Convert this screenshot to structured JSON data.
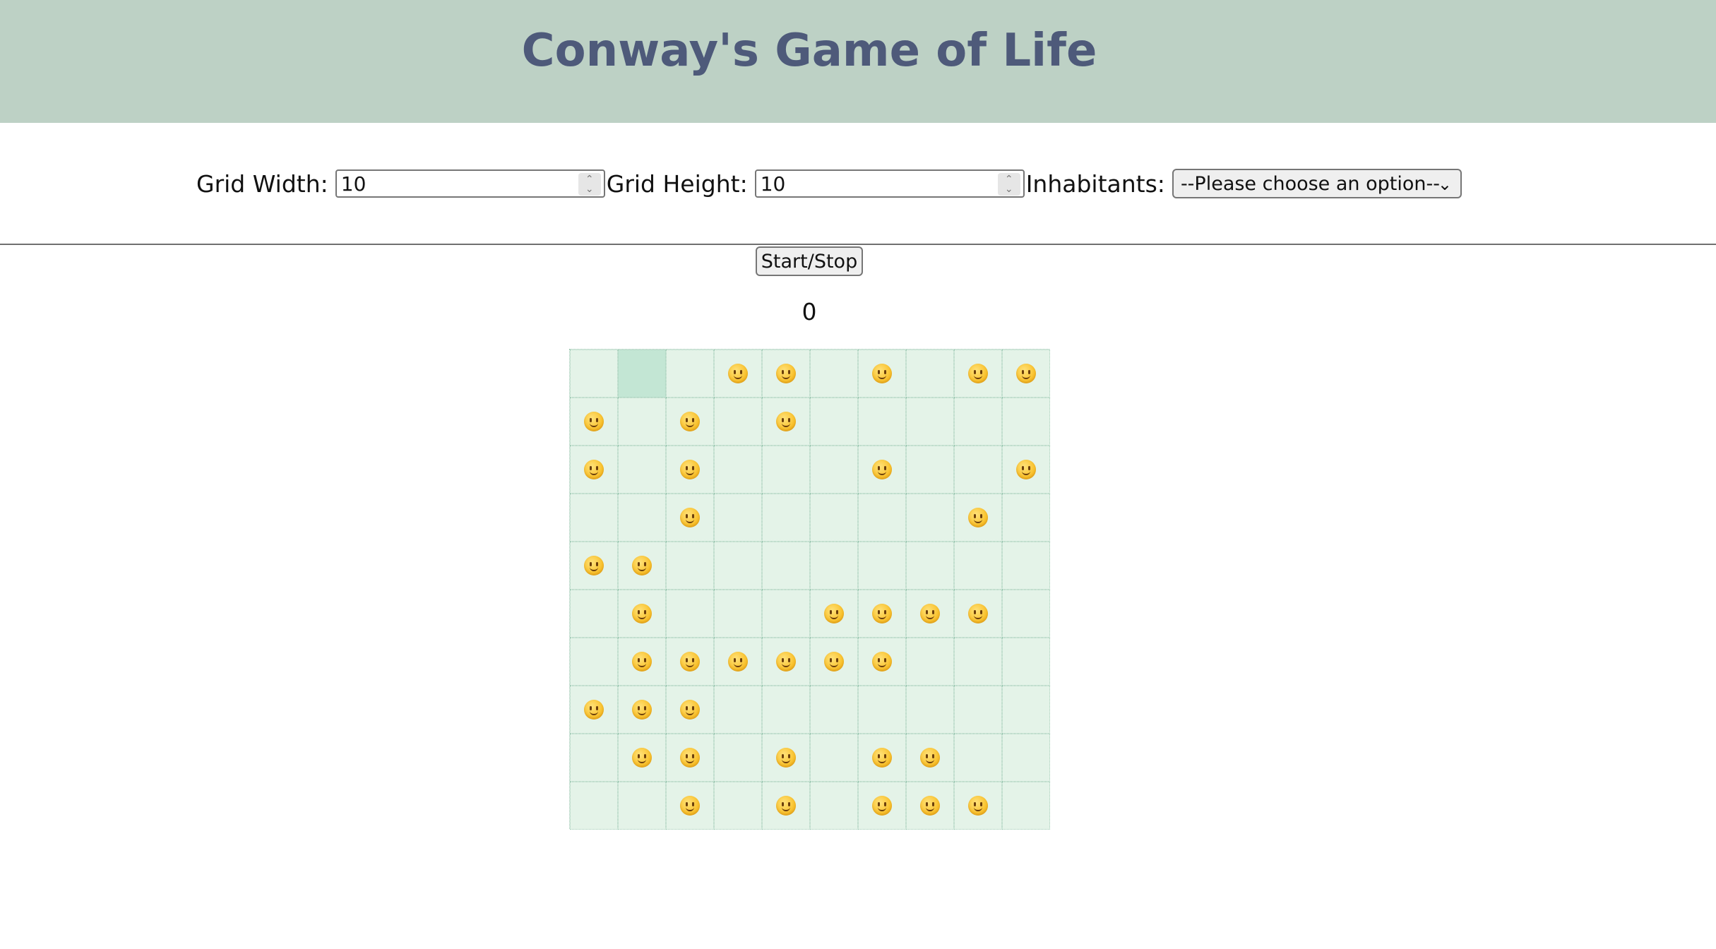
{
  "header": {
    "title": "Conway's Game of Life"
  },
  "controls": {
    "width_label": "Grid Width:",
    "width_value": "10",
    "height_label": "Grid Height:",
    "height_value": "10",
    "inhabitants_label": "Inhabitants:",
    "inhabitants_selected": "--Please choose an option--"
  },
  "start_stop_label": "Start/Stop",
  "generation": "0",
  "grid": {
    "rows": 10,
    "cols": 10,
    "inhabitant_icon": "smiley-face-icon",
    "highlighted_cell": [
      0,
      1
    ],
    "cells": [
      [
        0,
        0,
        0,
        1,
        1,
        0,
        1,
        0,
        1,
        1
      ],
      [
        1,
        0,
        1,
        0,
        1,
        0,
        0,
        0,
        0,
        0
      ],
      [
        1,
        0,
        1,
        0,
        0,
        0,
        1,
        0,
        0,
        1
      ],
      [
        0,
        0,
        1,
        0,
        0,
        0,
        0,
        0,
        1,
        0
      ],
      [
        1,
        1,
        0,
        0,
        0,
        0,
        0,
        0,
        0,
        0
      ],
      [
        0,
        1,
        0,
        0,
        0,
        1,
        1,
        1,
        1,
        0
      ],
      [
        0,
        1,
        1,
        1,
        1,
        1,
        1,
        0,
        0,
        0
      ],
      [
        1,
        1,
        1,
        0,
        0,
        0,
        0,
        0,
        0,
        0
      ],
      [
        0,
        1,
        1,
        0,
        1,
        0,
        1,
        1,
        0,
        0
      ],
      [
        0,
        0,
        1,
        0,
        1,
        0,
        1,
        1,
        1,
        0
      ]
    ]
  }
}
